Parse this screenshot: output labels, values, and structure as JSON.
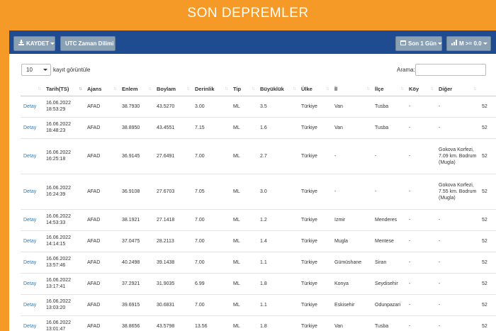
{
  "header": {
    "title": "SON DEPREMLER"
  },
  "toolbar": {
    "save_label": "KAYDET",
    "utc_label": "UTC Zaman Dilimi",
    "time_label": "Son 1 Gün",
    "mag_label": "M >= 0.0"
  },
  "controls": {
    "length_value": "10",
    "length_label": "kayıt görüntüle",
    "search_label": "Arama:",
    "search_value": ""
  },
  "table": {
    "columns": [
      "",
      "Tarih(TS)",
      "Ajans",
      "Enlem",
      "Boylam",
      "Derinlik",
      "Tip",
      "Büyüklük",
      "Ülke",
      "İl",
      "İlçe",
      "Köy",
      "Diğer",
      ""
    ],
    "rows": [
      [
        "Detay",
        "16.06.2022 18:53:29",
        "AFAD",
        "38.7930",
        "43.5270",
        "3.00",
        "ML",
        "3.5",
        "Türkiye",
        "Van",
        "Tusba",
        "-",
        "-",
        "52"
      ],
      [
        "Detay",
        "16.06.2022 18:48:23",
        "AFAD",
        "38.8950",
        "43.4551",
        "7.15",
        "ML",
        "1.6",
        "Türkiye",
        "Van",
        "Tusba",
        "-",
        "-",
        "52"
      ],
      [
        "Detay",
        "16.06.2022 16:25:18",
        "AFAD",
        "36.9145",
        "27.6491",
        "7.00",
        "ML",
        "2.7",
        "Türkiye",
        "-",
        "-",
        "-",
        "Gokova Korfezi, 7.09 km. Bodrum (Mugla)",
        "52"
      ],
      [
        "Detay",
        "16.06.2022 16:24:39",
        "AFAD",
        "36.9108",
        "27.6703",
        "7.05",
        "ML",
        "3.0",
        "Türkiye",
        "-",
        "-",
        "-",
        "Gokova Korfezi, 7.55 km. Bodrum (Mugla)",
        "52"
      ],
      [
        "Detay",
        "16.06.2022 14:53:33",
        "AFAD",
        "38.1921",
        "27.1418",
        "7.00",
        "ML",
        "1.2",
        "Türkiye",
        "Izmir",
        "Menderes",
        "-",
        "-",
        "52"
      ],
      [
        "Detay",
        "16.06.2022 14:14:15",
        "AFAD",
        "37.0475",
        "28.2113",
        "7.00",
        "ML",
        "1.4",
        "Türkiye",
        "Mugla",
        "Mentese",
        "-",
        "-",
        "52"
      ],
      [
        "Detay",
        "16.06.2022 13:57:46",
        "AFAD",
        "40.2498",
        "39.1438",
        "7.00",
        "ML",
        "1.1",
        "Türkiye",
        "Gümüshane",
        "Siran",
        "-",
        "-",
        "52"
      ],
      [
        "Detay",
        "16.06.2022 13:17:41",
        "AFAD",
        "37.2921",
        "31.9035",
        "6.99",
        "ML",
        "1.8",
        "Türkiye",
        "Konya",
        "Seydisehir",
        "-",
        "-",
        "52"
      ],
      [
        "Detay",
        "16.06.2022 13:03:20",
        "AFAD",
        "39.6915",
        "30.6831",
        "7.00",
        "ML",
        "1.1",
        "Türkiye",
        "Eskisehir",
        "Odunpazari",
        "-",
        "-",
        "52"
      ],
      [
        "Detay",
        "16.06.2022 13:01:47",
        "AFAD",
        "38.8656",
        "43.5798",
        "13.56",
        "ML",
        "1.8",
        "Türkiye",
        "Van",
        "Tusba",
        "-",
        "-",
        "52"
      ]
    ]
  }
}
